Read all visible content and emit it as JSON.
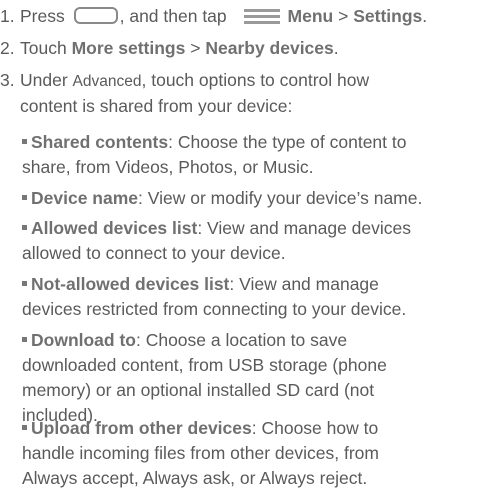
{
  "steps": [
    {
      "num": "1.",
      "t1": "Press",
      "t2": ", and then tap",
      "b1": "Menu",
      "sep": ">",
      "b2": "Settings",
      "t3": "."
    },
    {
      "num": "2.",
      "t1": "Touch",
      "b1": "More settings",
      "sep": ">",
      "b2": "Nearby devices",
      "t2": "."
    },
    {
      "num": "3.",
      "t1": "Under",
      "small": "Advanced",
      "t2": ", touch options to control how",
      "line2": "content is shared from your device:"
    }
  ],
  "options": [
    {
      "label": "Shared contents",
      "line1": ": Choose the type of content to",
      "rest": [
        "share, from Videos, Photos, or Music."
      ]
    },
    {
      "label": "Device name",
      "line1": ": View or modify your device’s name.",
      "rest": []
    },
    {
      "label": "Allowed devices list",
      "line1": ": View and manage devices",
      "rest": [
        "allowed to connect to your device."
      ]
    },
    {
      "label": "Not-allowed devices list",
      "line1": ": View and manage",
      "rest": [
        "devices restricted from connecting to your device."
      ]
    },
    {
      "label": "Download to",
      "line1": ": Choose a location to save",
      "rest": [
        "downloaded content, from USB storage (phone",
        "memory) or an optional installed SD card (not",
        "included)."
      ]
    },
    {
      "label": "Upload from other devices",
      "line1": ": Choose how to",
      "rest": [
        "handle incoming files from other devices, from",
        "Always accept, Always ask, or Always reject."
      ]
    }
  ],
  "icons": {
    "home": "home-key-icon",
    "menu": "menu-key-icon"
  }
}
